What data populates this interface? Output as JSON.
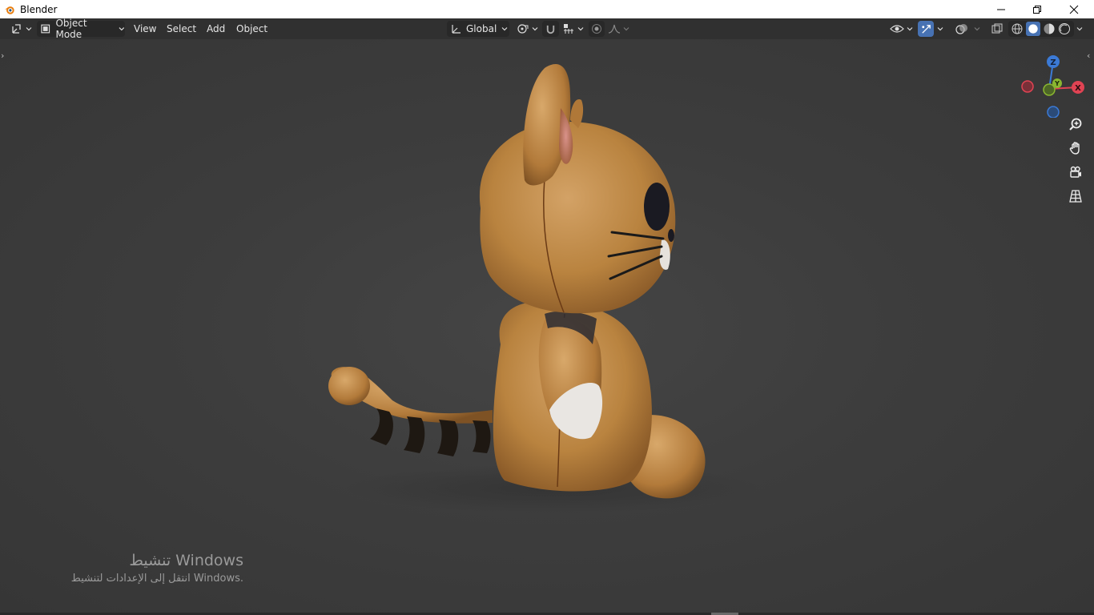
{
  "window": {
    "title": "Blender"
  },
  "header": {
    "mode_label": "Object Mode",
    "menus": [
      "View",
      "Select",
      "Add",
      "Object"
    ],
    "transform_orientation": "Global"
  },
  "viewport": {
    "gizmo_axes": {
      "x": "X",
      "y": "Y",
      "z": "Z"
    },
    "nav_buttons": [
      "zoom-icon",
      "pan-hand-icon",
      "camera-view-icon",
      "perspective-grid-icon"
    ]
  },
  "watermark": {
    "line1": "تنشيط Windows",
    "line2": "انتقل إلى الإعدادات لتنشيط Windows."
  },
  "colors": {
    "accent": "#4772b3",
    "axis_x": "#e04353",
    "axis_y": "#8ab630",
    "axis_z": "#3b7ad6"
  }
}
